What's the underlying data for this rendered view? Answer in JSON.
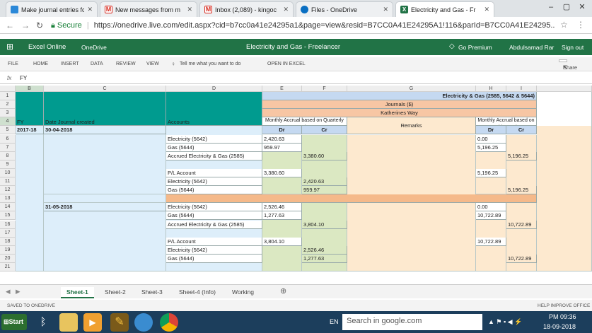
{
  "browser": {
    "tabs": [
      {
        "title": "Make journal entries fo",
        "color": "#2b88d8"
      },
      {
        "title": "New messages from m",
        "color": "#d93025"
      },
      {
        "title": "Inbox (2,089) - kingoc",
        "color": "#d93025"
      },
      {
        "title": "Files - OneDrive",
        "color": "#0a6fc2"
      },
      {
        "title": "Electricity and Gas - Fr",
        "color": "#217346"
      }
    ],
    "secure_label": "Secure",
    "url": "https://onedrive.live.com/edit.aspx?cid=b7cc0a41e24295a1&page=view&resid=B7CC0A41E24295A1!116&parId=B7CC0A41E24295..."
  },
  "app": {
    "product": "Excel Online",
    "onedrive": "OneDrive",
    "doc_title": "Electricity and Gas - Freelancer",
    "go_premium": "Go Premium",
    "user": "Abdulsamad Rar",
    "sign_out": "Sign out"
  },
  "ribbon": {
    "menus": [
      "FILE",
      "HOME",
      "INSERT",
      "DATA",
      "REVIEW",
      "VIEW"
    ],
    "tell_me": "Tell me what you want to do",
    "open_in_excel": "OPEN IN EXCEL",
    "share": "Share"
  },
  "formula_bar": {
    "fx": "fx",
    "value": "FY"
  },
  "grid": {
    "columns": [
      "B",
      "C",
      "D",
      "E",
      "F",
      "G",
      "H",
      "I"
    ],
    "rows": [
      "1",
      "2",
      "3",
      "4",
      "5",
      "6",
      "7",
      "8",
      "9",
      "10",
      "11",
      "12",
      "13",
      "14",
      "15",
      "16",
      "17",
      "18",
      "19",
      "20",
      "21"
    ],
    "title": "Electricity & Gas (2585, 5642 & 5644)",
    "subtitle": "Journals ($)",
    "owner": "Katherines Way",
    "headers": {
      "fy": "FY",
      "date": "Date Journal created",
      "accounts": "Accounts",
      "quarterly": "Monthly Accrual based on Quarterly Invoices",
      "remarks": "Remarks",
      "monthly": "Monthly Accrual based on Monthly Invoices",
      "dr": "Dr",
      "cr": "Cr"
    },
    "fy_value": "2017-18",
    "dates": [
      "30-04-2018",
      "31-05-2018"
    ],
    "entries": [
      {
        "row": 6,
        "account": "Electricity (5642)",
        "e": "2,420.63",
        "f": "",
        "h": "0.00",
        "i": ""
      },
      {
        "row": 7,
        "account": "Gas (5644)",
        "e": "959.97",
        "f": "",
        "h": "5,196.25",
        "i": ""
      },
      {
        "row": 8,
        "account": "Accrued Electricity & Gas (2585)",
        "e": "",
        "f": "3,380.60",
        "h": "",
        "i": "5,196.25"
      },
      {
        "row": 10,
        "account": "P/L Account",
        "e": "3,380.60",
        "f": "",
        "h": "5,196.25",
        "i": ""
      },
      {
        "row": 11,
        "account": "Electricity (5642)",
        "e": "",
        "f": "2,420.63",
        "h": "",
        "i": ""
      },
      {
        "row": 12,
        "account": "Gas (5644)",
        "e": "",
        "f": "959.97",
        "h": "",
        "i": "5,196.25"
      },
      {
        "row": 14,
        "account": "Electricity (5642)",
        "e": "2,526.46",
        "f": "",
        "h": "0.00",
        "i": ""
      },
      {
        "row": 15,
        "account": "Gas (5644)",
        "e": "1,277.63",
        "f": "",
        "h": "10,722.89",
        "i": ""
      },
      {
        "row": 16,
        "account": "Accrued Electricity & Gas (2585)",
        "e": "",
        "f": "3,804.10",
        "h": "",
        "i": "10,722.89"
      },
      {
        "row": 18,
        "account": "P/L Account",
        "e": "3,804.10",
        "f": "",
        "h": "10,722.89",
        "i": ""
      },
      {
        "row": 19,
        "account": "Electricity (5642)",
        "e": "",
        "f": "2,526.46",
        "h": "",
        "i": ""
      },
      {
        "row": 20,
        "account": "Gas (5644)",
        "e": "",
        "f": "1,277.63",
        "h": "",
        "i": "10,722.89"
      }
    ]
  },
  "sheet_tabs": [
    "Sheet-1",
    "Sheet-2",
    "Sheet-3",
    "Sheet-4 (Info)",
    "Working"
  ],
  "status": {
    "left": "SAVED TO ONEDRIVE",
    "right": "HELP IMPROVE OFFICE"
  },
  "taskbar": {
    "start": "Start",
    "lang": "EN",
    "search_placeholder": "Search in google.com",
    "time": "PM 09:36",
    "date": "18-09-2018"
  },
  "colors": {
    "excel_green": "#217346",
    "teal": "#009b8f",
    "light_blue": "#ddeefa",
    "col_e_f": "#dbe8c2",
    "remarks": "#fde9cf",
    "title_blue": "#c5d9f1",
    "journal_orange": "#f7c6a4",
    "separator": "#f5b98a"
  }
}
